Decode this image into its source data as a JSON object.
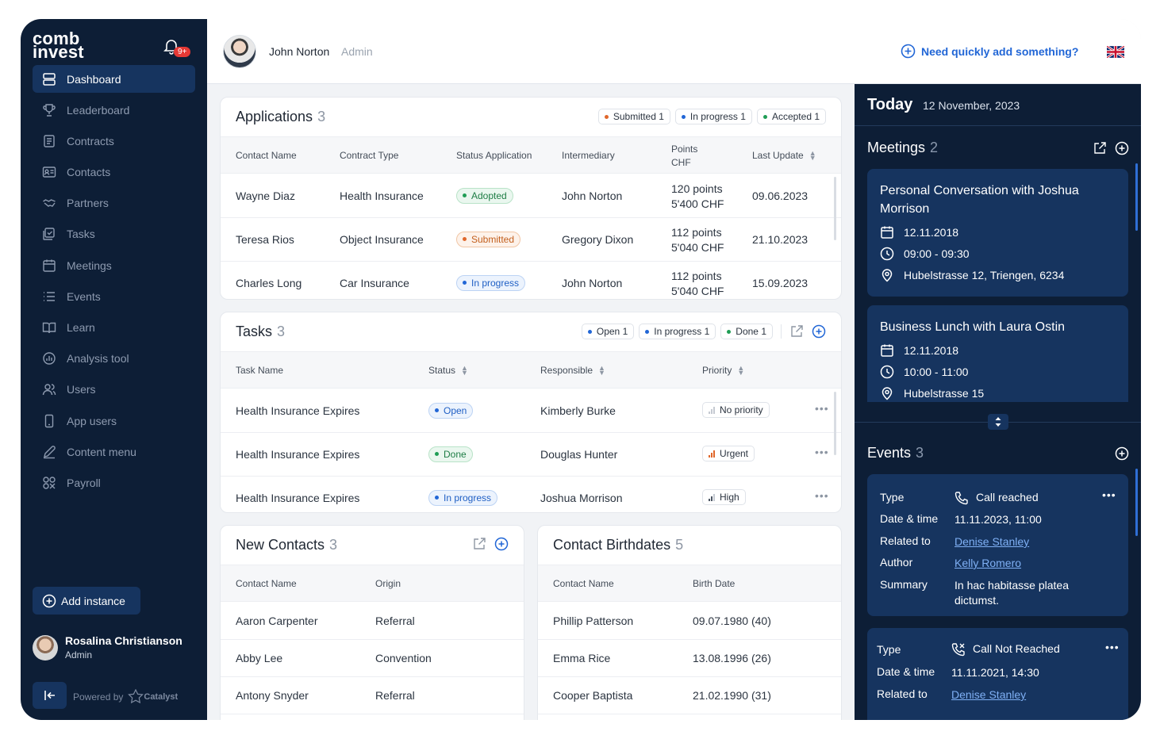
{
  "sidebar": {
    "logo_line1": "comb",
    "logo_line2": "invest",
    "notification_count": "9+",
    "items": [
      {
        "label": "Dashboard",
        "icon": "dashboard-icon"
      },
      {
        "label": "Leaderboard",
        "icon": "trophy-icon"
      },
      {
        "label": "Contracts",
        "icon": "document-icon"
      },
      {
        "label": "Contacts",
        "icon": "contact-card-icon"
      },
      {
        "label": "Partners",
        "icon": "handshake-icon"
      },
      {
        "label": "Tasks",
        "icon": "tasks-icon"
      },
      {
        "label": "Meetings",
        "icon": "calendar-icon"
      },
      {
        "label": "Events",
        "icon": "list-icon"
      },
      {
        "label": "Learn",
        "icon": "book-icon"
      },
      {
        "label": "Analysis tool",
        "icon": "analysis-icon"
      },
      {
        "label": "Users",
        "icon": "users-icon"
      },
      {
        "label": "App users",
        "icon": "phone-icon"
      },
      {
        "label": "Content menu",
        "icon": "pen-icon"
      },
      {
        "label": "Payroll",
        "icon": "payroll-icon"
      }
    ],
    "add_instance": "Add instance",
    "profile": {
      "name": "Rosalina Christianson",
      "role": "Admin"
    },
    "powered_by": "Powered by",
    "powered_brand": "Catalyst"
  },
  "header": {
    "user_name": "John Norton",
    "user_role": "Admin",
    "quick_add": "Need quickly add something?"
  },
  "applications": {
    "title": "Applications",
    "count": "3",
    "filters": [
      {
        "label": "Submitted 1",
        "color": "#e0672b"
      },
      {
        "label": "In progress 1",
        "color": "#2166d6"
      },
      {
        "label": "Accepted 1",
        "color": "#1f9d55"
      }
    ],
    "columns": [
      "Contact Name",
      "Contract Type",
      "Status Application",
      "Intermediary",
      "Points",
      "CHF",
      "Last Update"
    ],
    "rows": [
      {
        "name": "Wayne Diaz",
        "type": "Health Insurance",
        "status": "Adopted",
        "intermediary": "John Norton",
        "points": "120 points",
        "chf": "5'400 CHF",
        "updated": "09.06.2023"
      },
      {
        "name": "Teresa Rios",
        "type": "Object Insurance",
        "status": "Submitted",
        "intermediary": "Gregory Dixon",
        "points": "112 points",
        "chf": "5'040 CHF",
        "updated": "21.10.2023"
      },
      {
        "name": "Charles Long",
        "type": "Car Insurance",
        "status": "In progress",
        "intermediary": "John Norton",
        "points": "112 points",
        "chf": "5'040 CHF",
        "updated": "15.09.2023"
      }
    ]
  },
  "tasks": {
    "title": "Tasks",
    "count": "3",
    "filters": [
      {
        "label": "Open 1",
        "color": "#2166d6"
      },
      {
        "label": "In progress 1",
        "color": "#2166d6"
      },
      {
        "label": "Done 1",
        "color": "#1f9d55"
      }
    ],
    "columns": [
      "Task Name",
      "Status",
      "Responsible",
      "Priority"
    ],
    "rows": [
      {
        "name": "Health Insurance Expires",
        "status": "Open",
        "responsible": "Kimberly Burke",
        "priority": "No priority"
      },
      {
        "name": "Health Insurance Expires",
        "status": "Done",
        "responsible": "Douglas Hunter",
        "priority": "Urgent"
      },
      {
        "name": "Health Insurance Expires",
        "status": "In progress",
        "responsible": "Joshua Morrison",
        "priority": "High"
      }
    ]
  },
  "new_contacts": {
    "title": "New Contacts",
    "count": "3",
    "columns": [
      "Contact Name",
      "Origin"
    ],
    "rows": [
      {
        "name": "Aaron Carpenter",
        "origin": "Referral"
      },
      {
        "name": "Abby Lee",
        "origin": "Convention"
      },
      {
        "name": "Antony Snyder",
        "origin": "Referral"
      }
    ]
  },
  "birthdates": {
    "title": "Contact Birthdates",
    "count": "5",
    "columns": [
      "Contact Name",
      "Birth Date"
    ],
    "rows": [
      {
        "name": "Phillip Patterson",
        "date": "09.07.1980 (40)"
      },
      {
        "name": "Emma Rice",
        "date": "13.08.1996 (26)"
      },
      {
        "name": "Cooper Baptista",
        "date": "21.02.1990 (31)"
      }
    ]
  },
  "today": {
    "label": "Today",
    "date": "12 November, 2023",
    "meetings_title": "Meetings",
    "meetings_count": "2",
    "meetings": [
      {
        "title": "Personal Conversation with Joshua Morrison",
        "date": "12.11.2018",
        "time": "09:00 - 09:30",
        "place": "Hubelstrasse 12, Triengen, 6234"
      },
      {
        "title": "Business Lunch with Laura Ostin",
        "date": "12.11.2018",
        "time": "10:00 - 11:00",
        "place": "Hubelstrasse 15"
      }
    ],
    "events_title": "Events",
    "events_count": "3",
    "event_labels": {
      "type": "Type",
      "datetime": "Date & time",
      "related": "Related to",
      "author": "Author",
      "summary": "Summary"
    },
    "events": [
      {
        "type": "Call reached",
        "datetime": "11.11.2023, 11:00",
        "related": "Denise Stanley",
        "author": "Kelly Romero",
        "summary": "In hac habitasse platea dictumst."
      },
      {
        "type": "Call Not Reached",
        "datetime": "11.11.2021, 14:30",
        "related": "Denise Stanley"
      }
    ]
  }
}
